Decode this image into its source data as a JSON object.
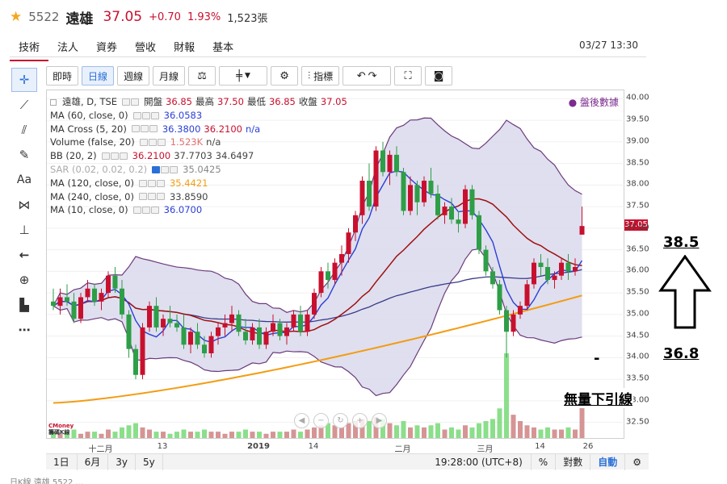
{
  "header": {
    "star": "★",
    "code": "5522",
    "name": "遠雄",
    "price": "37.05",
    "change": "+0.70",
    "change_pct": "1.93%",
    "volume": "1,523張"
  },
  "tabs": [
    {
      "label": "技術",
      "active": true
    },
    {
      "label": "法人"
    },
    {
      "label": "資券"
    },
    {
      "label": "營收"
    },
    {
      "label": "財報"
    },
    {
      "label": "基本"
    }
  ],
  "datetime": "03/27 13:30",
  "toolbar": {
    "tick": "即時",
    "daily": "日線",
    "weekly": "週線",
    "monthly": "月線",
    "indicators": "指標"
  },
  "legend": {
    "main_symbol": "遠雄, D, TSE",
    "open_label": "開盤",
    "open": "36.85",
    "high_label": "最高",
    "high": "37.50",
    "low_label": "最低",
    "low": "36.85",
    "close_label": "收盤",
    "close": "37.05",
    "ma60_name": "MA (60, close, 0)",
    "ma60_val": "36.0583",
    "macross_name": "MA Cross (5, 20)",
    "macross_v1": "36.3800",
    "macross_v2": "36.2100",
    "macross_v3": "n/a",
    "volume_name": "Volume (false, 20)",
    "volume_v1": "1.523K",
    "volume_v2": "n/a",
    "bb_name": "BB (20, 2)",
    "bb_v1": "36.2100",
    "bb_v2": "37.7703",
    "bb_v3": "34.6497",
    "sar_name": "SAR (0.02, 0.02, 0.2)",
    "sar_val": "35.0425",
    "ma120_name": "MA (120, close, 0)",
    "ma120_val": "35.4421",
    "ma240_name": "MA (240, close, 0)",
    "ma240_val": "33.8590",
    "ma10_name": "MA (10, close, 0)",
    "ma10_val": "36.0700"
  },
  "after_hours": "盤後數據",
  "yaxis": {
    "ticks": [
      "40.00",
      "39.50",
      "39.00",
      "38.50",
      "38.00",
      "37.50",
      "37.00",
      "36.50",
      "36.00",
      "35.50",
      "35.00",
      "34.50",
      "34.00",
      "33.50",
      "33.00",
      "32.50"
    ],
    "last_price_tag": "37.05"
  },
  "xaxis": {
    "ticks": [
      "十二月",
      "13",
      "2019",
      "14",
      "二月",
      "三月",
      "14",
      "26"
    ]
  },
  "bottom": {
    "range_1d": "1日",
    "range_6m": "6月",
    "range_3y": "3y",
    "range_5y": "5y",
    "time": "19:28:00 (UTC+8)",
    "percent": "%",
    "log": "對數",
    "auto": "自動"
  },
  "logo": {
    "line1": "CMoney",
    "line2": "籌碼K線"
  },
  "annotations": {
    "high": "38.5",
    "low": "36.8",
    "note": "無量下引線",
    "dash": "-"
  },
  "cut_text": "日K線 遠雄 5522 ...",
  "colors": {
    "up": "#c8102e",
    "down": "#2e9e47",
    "ma60": "#3a3a8a",
    "ma5": "#2a3fd6",
    "ma20": "#a01010",
    "ma120": "#f39c12",
    "bb": "#6b3a7a",
    "bb_fill": "#d9d9ec"
  },
  "chart_data": {
    "type": "candlestick",
    "ylim": [
      32.1,
      40.1
    ],
    "candles": [
      [
        35.3,
        35.6,
        35.1,
        35.2
      ],
      [
        35.2,
        35.6,
        35.0,
        35.4
      ],
      [
        35.4,
        35.7,
        35.2,
        35.3
      ],
      [
        35.3,
        35.5,
        34.8,
        34.9
      ],
      [
        34.9,
        35.5,
        34.8,
        35.4
      ],
      [
        35.4,
        35.8,
        35.3,
        35.6
      ],
      [
        35.6,
        35.7,
        35.2,
        35.3
      ],
      [
        35.3,
        35.6,
        35.1,
        35.5
      ],
      [
        35.5,
        36.0,
        35.4,
        35.9
      ],
      [
        35.9,
        36.1,
        35.5,
        35.6
      ],
      [
        35.6,
        35.8,
        34.9,
        35.0
      ],
      [
        35.0,
        35.1,
        34.0,
        34.2
      ],
      [
        34.2,
        34.3,
        33.5,
        33.6
      ],
      [
        33.6,
        34.8,
        33.5,
        34.7
      ],
      [
        34.7,
        35.3,
        34.6,
        35.2
      ],
      [
        35.2,
        35.4,
        34.6,
        34.7
      ],
      [
        34.7,
        35.0,
        34.5,
        34.9
      ],
      [
        34.9,
        35.2,
        34.7,
        34.8
      ],
      [
        34.8,
        35.0,
        34.6,
        34.7
      ],
      [
        34.7,
        35.0,
        34.2,
        34.3
      ],
      [
        34.3,
        34.7,
        34.1,
        34.6
      ],
      [
        34.6,
        34.8,
        34.2,
        34.3
      ],
      [
        34.3,
        34.5,
        34.0,
        34.1
      ],
      [
        34.1,
        34.6,
        34.0,
        34.5
      ],
      [
        34.5,
        34.8,
        34.3,
        34.7
      ],
      [
        34.7,
        35.0,
        34.5,
        34.8
      ],
      [
        34.8,
        35.2,
        34.6,
        35.0
      ],
      [
        35.0,
        35.1,
        34.5,
        34.6
      ],
      [
        34.6,
        34.9,
        34.3,
        34.4
      ],
      [
        34.4,
        34.8,
        34.3,
        34.7
      ],
      [
        34.7,
        34.9,
        34.2,
        34.3
      ],
      [
        34.3,
        34.7,
        34.2,
        34.6
      ],
      [
        34.6,
        35.0,
        34.5,
        34.8
      ],
      [
        34.8,
        34.9,
        34.4,
        34.5
      ],
      [
        34.5,
        34.8,
        34.3,
        34.7
      ],
      [
        34.7,
        35.1,
        34.6,
        35.0
      ],
      [
        35.0,
        35.2,
        34.5,
        34.6
      ],
      [
        34.6,
        35.1,
        34.5,
        35.0
      ],
      [
        35.0,
        35.6,
        34.9,
        35.5
      ],
      [
        35.5,
        36.1,
        35.4,
        36.0
      ],
      [
        36.0,
        36.2,
        35.6,
        35.8
      ],
      [
        35.8,
        36.3,
        35.7,
        36.2
      ],
      [
        36.2,
        36.6,
        35.9,
        36.4
      ],
      [
        36.4,
        37.0,
        36.2,
        36.9
      ],
      [
        36.9,
        37.4,
        36.7,
        37.3
      ],
      [
        37.3,
        38.2,
        37.1,
        38.1
      ],
      [
        38.1,
        38.5,
        37.4,
        37.5
      ],
      [
        37.5,
        38.9,
        37.4,
        38.8
      ],
      [
        38.8,
        39.0,
        38.2,
        38.3
      ],
      [
        38.3,
        38.8,
        38.0,
        38.7
      ],
      [
        38.7,
        38.9,
        38.2,
        38.3
      ],
      [
        38.3,
        38.4,
        37.3,
        37.4
      ],
      [
        37.4,
        38.2,
        37.3,
        38.0
      ],
      [
        38.0,
        38.1,
        37.3,
        37.6
      ],
      [
        37.6,
        38.2,
        37.5,
        38.1
      ],
      [
        38.1,
        38.4,
        37.7,
        37.8
      ],
      [
        37.8,
        38.0,
        37.2,
        37.3
      ],
      [
        37.3,
        37.6,
        37.1,
        37.5
      ],
      [
        37.5,
        37.7,
        37.1,
        37.2
      ],
      [
        37.2,
        37.4,
        36.9,
        37.1
      ],
      [
        37.1,
        38.0,
        37.0,
        37.9
      ],
      [
        37.9,
        38.0,
        37.2,
        37.3
      ],
      [
        37.3,
        37.4,
        36.4,
        36.5
      ],
      [
        36.5,
        36.6,
        35.9,
        36.0
      ],
      [
        36.0,
        36.1,
        35.6,
        35.7
      ],
      [
        35.7,
        35.8,
        35.0,
        35.1
      ],
      [
        35.1,
        35.2,
        34.0,
        34.6
      ],
      [
        34.6,
        35.1,
        34.5,
        35.0
      ],
      [
        35.0,
        35.3,
        34.9,
        35.2
      ],
      [
        35.2,
        35.8,
        35.1,
        35.7
      ],
      [
        35.7,
        36.3,
        35.6,
        36.2
      ],
      [
        36.2,
        36.4,
        35.9,
        36.1
      ],
      [
        36.1,
        36.3,
        35.7,
        35.8
      ],
      [
        35.8,
        36.0,
        35.6,
        35.9
      ],
      [
        35.9,
        36.3,
        35.8,
        36.2
      ],
      [
        36.2,
        36.4,
        35.8,
        36.0
      ],
      [
        36.0,
        36.3,
        35.9,
        36.1
      ],
      [
        36.85,
        37.5,
        36.85,
        37.05
      ]
    ],
    "volumes": [
      0.3,
      0.2,
      0.3,
      0.4,
      0.2,
      0.3,
      0.3,
      0.2,
      0.4,
      0.3,
      0.5,
      0.6,
      0.7,
      0.5,
      0.4,
      0.3,
      0.3,
      0.2,
      0.3,
      0.4,
      0.3,
      0.3,
      0.4,
      0.3,
      0.3,
      0.2,
      0.3,
      0.3,
      0.4,
      0.3,
      0.3,
      0.2,
      0.3,
      0.3,
      0.3,
      0.4,
      0.3,
      0.4,
      0.5,
      0.6,
      0.7,
      0.6,
      0.5,
      0.7,
      0.8,
      0.9,
      0.8,
      1.0,
      0.9,
      0.7,
      0.6,
      0.8,
      0.5,
      0.6,
      0.5,
      0.6,
      0.7,
      0.4,
      0.5,
      0.4,
      0.6,
      0.5,
      0.7,
      0.8,
      0.9,
      1.4,
      4.0,
      1.1,
      0.8,
      0.6,
      0.5,
      0.4,
      0.5,
      0.4,
      0.4,
      0.5,
      0.4,
      1.5
    ]
  }
}
